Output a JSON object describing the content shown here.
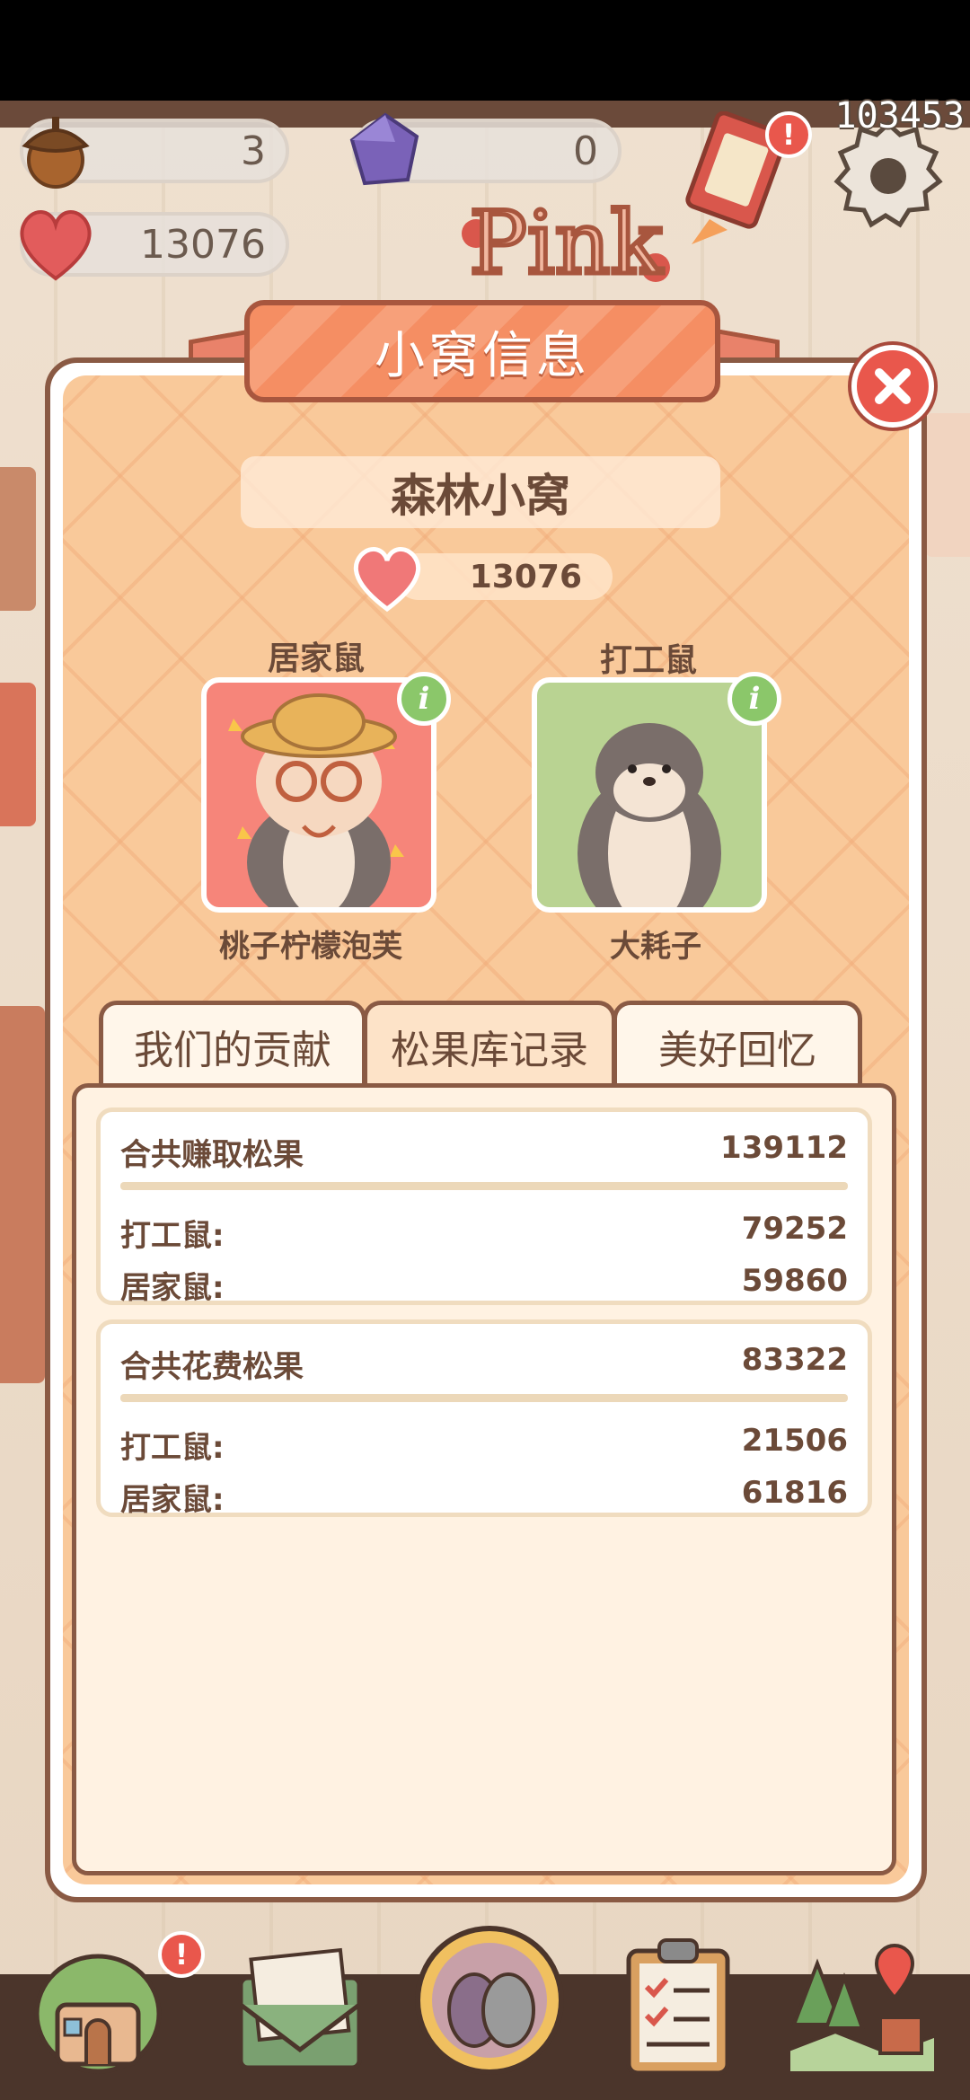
{
  "hud": {
    "acorn_count": "3",
    "gem_count": "0",
    "heart_total": "13076",
    "score": "103453"
  },
  "modal": {
    "title": "小窝信息",
    "nest_name": "森林小窝",
    "likes": "13076",
    "residents": [
      {
        "role": "居家鼠",
        "name": "桃子柠檬泡芙"
      },
      {
        "role": "打工鼠",
        "name": "大耗子"
      }
    ],
    "tabs": [
      {
        "label": "我们的贡献",
        "active": false
      },
      {
        "label": "松果库记录",
        "active": true
      },
      {
        "label": "美好回忆",
        "active": false
      }
    ],
    "earned": {
      "label": "合共赚取松果",
      "total": "139112",
      "rows": [
        {
          "label": "打工鼠:",
          "value": "79252"
        },
        {
          "label": "居家鼠:",
          "value": "59860"
        }
      ]
    },
    "spent": {
      "label": "合共花费松果",
      "total": "83322",
      "rows": [
        {
          "label": "打工鼠:",
          "value": "21506"
        },
        {
          "label": "居家鼠:",
          "value": "61816"
        }
      ]
    }
  },
  "sign_text": "Pink",
  "badges": {
    "event": "!",
    "house": "!"
  },
  "info_glyph": "i",
  "colors": {
    "panel_orange": "#f9c99a",
    "banner": "#f58e63",
    "border_brown": "#8a5a44",
    "text_brown": "#6b4a38",
    "close_red": "#e9574c",
    "info_green": "#8bc76a"
  }
}
